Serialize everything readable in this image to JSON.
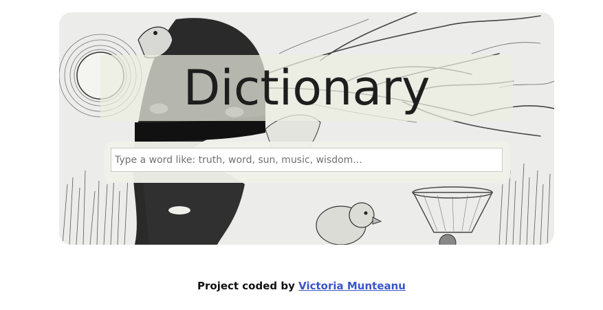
{
  "hero": {
    "title": "Dictionary",
    "background_image": "pen-and-ink-illustration"
  },
  "search": {
    "placeholder": "Type a word like: truth, word, sun, music, wisdom...",
    "value": ""
  },
  "footer": {
    "prefix": "Project coded by",
    "author_link": "Victoria Munteanu"
  },
  "colors": {
    "link": "#3b55c9",
    "title": "#1e1e1e",
    "panel": "#eff0e8"
  }
}
